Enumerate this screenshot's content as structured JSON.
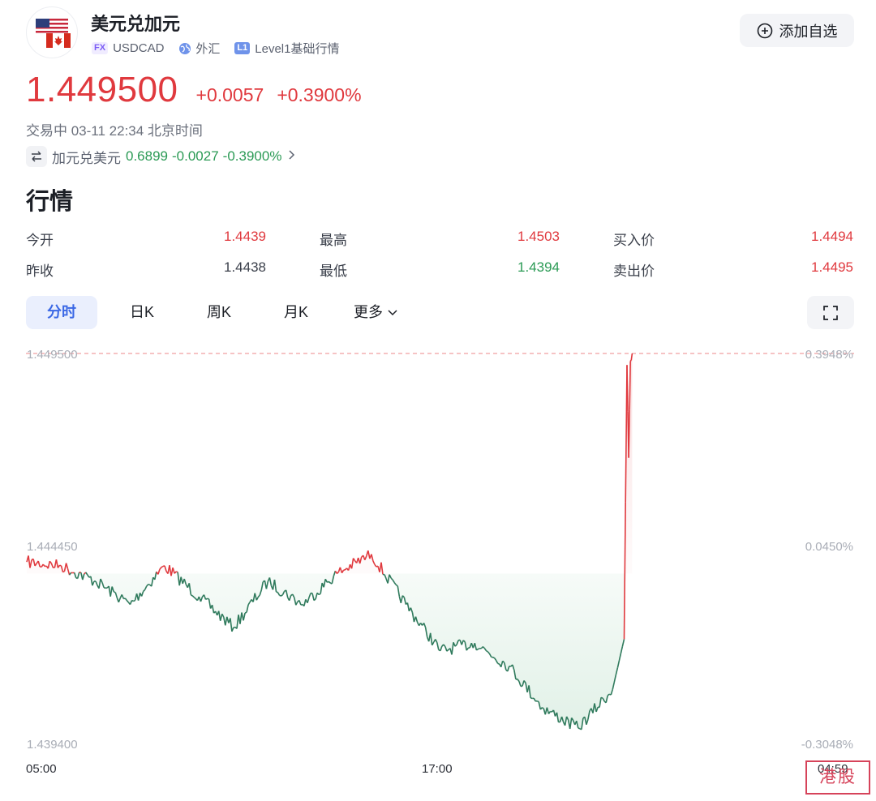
{
  "header": {
    "title": "美元兑加元",
    "symbol_badge": "FX",
    "symbol": "USDCAD",
    "market": "外汇",
    "level_badge": "L1",
    "level": "Level1基础行情",
    "add_watchlist": "添加自选"
  },
  "quote": {
    "price": "1.449500",
    "change": "+0.0057",
    "change_pct": "+0.3900%",
    "status": "交易中 03-11 22:34 北京时间",
    "inverse_name": "加元兑美元",
    "inverse_price": "0.6899",
    "inverse_change": "-0.0027",
    "inverse_change_pct": "-0.3900%"
  },
  "section_title": "行情",
  "stats": {
    "open_label": "今开",
    "open": "1.4439",
    "high_label": "最高",
    "high": "1.4503",
    "bid_label": "买入价",
    "bid": "1.4494",
    "prev_close_label": "昨收",
    "prev_close": "1.4438",
    "low_label": "最低",
    "low": "1.4394",
    "ask_label": "卖出价",
    "ask": "1.4495"
  },
  "tabs": [
    "分时",
    "日K",
    "周K",
    "月K",
    "更多"
  ],
  "colors": {
    "up": "#e0393e",
    "down": "#2b9a55",
    "line_down": "#2f7a5c",
    "accent": "#3b68e5"
  },
  "chart_data": {
    "type": "line",
    "y_ticks": [
      "1.449500",
      "1.444450",
      "1.439400"
    ],
    "y_right_ticks": [
      "0.3948%",
      "0.0450%",
      "-0.3048%"
    ],
    "x_ticks": [
      "05:00",
      "17:00",
      "04:59"
    ],
    "ylim": [
      1.4394,
      1.4495
    ],
    "reference_price": 1.4438,
    "series": [
      {
        "points": [
          [
            "05:00",
            1.4441
          ],
          [
            "06:00",
            1.444
          ],
          [
            "07:00",
            1.4436
          ],
          [
            "08:00",
            1.443
          ],
          [
            "09:00",
            1.444
          ],
          [
            "10:00",
            1.4432
          ],
          [
            "11:00",
            1.4424
          ],
          [
            "12:00",
            1.4436
          ],
          [
            "13:00",
            1.443
          ],
          [
            "14:00",
            1.4438
          ],
          [
            "15:00",
            1.4443
          ],
          [
            "16:00",
            1.443
          ],
          [
            "17:00",
            1.4418
          ],
          [
            "18:00",
            1.442
          ],
          [
            "19:00",
            1.4414
          ],
          [
            "20:00",
            1.4403
          ],
          [
            "21:00",
            1.4398
          ],
          [
            "22:00",
            1.4408
          ],
          [
            "22:20",
            1.4421
          ],
          [
            "22:25",
            1.4492
          ],
          [
            "22:28",
            1.4468
          ],
          [
            "22:31",
            1.4493
          ],
          [
            "22:34",
            1.4495
          ]
        ]
      }
    ]
  },
  "watermark": "港股"
}
